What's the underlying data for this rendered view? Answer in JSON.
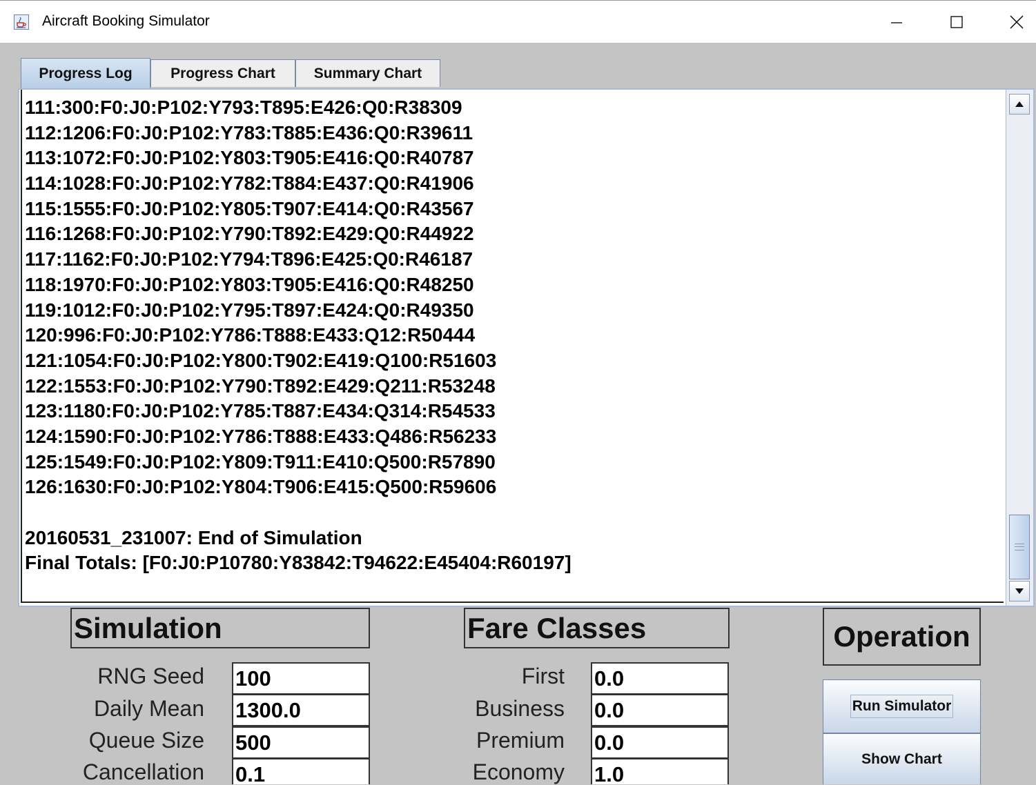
{
  "window": {
    "title": "Aircraft Booking Simulator",
    "icon": "java-cup-icon",
    "controls": [
      "minimize-icon",
      "maximize-icon",
      "close-icon"
    ]
  },
  "tabs": [
    {
      "label": "Progress Log",
      "active": true
    },
    {
      "label": "Progress Chart",
      "active": false
    },
    {
      "label": "Summary Chart",
      "active": false
    }
  ],
  "log": {
    "lines": [
      "111:300:F0:J0:P102:Y793:T895:E426:Q0:R38309",
      "112:1206:F0:J0:P102:Y783:T885:E436:Q0:R39611",
      "113:1072:F0:J0:P102:Y803:T905:E416:Q0:R40787",
      "114:1028:F0:J0:P102:Y782:T884:E437:Q0:R41906",
      "115:1555:F0:J0:P102:Y805:T907:E414:Q0:R43567",
      "116:1268:F0:J0:P102:Y790:T892:E429:Q0:R44922",
      "117:1162:F0:J0:P102:Y794:T896:E425:Q0:R46187",
      "118:1970:F0:J0:P102:Y803:T905:E416:Q0:R48250",
      "119:1012:F0:J0:P102:Y795:T897:E424:Q0:R49350",
      "120:996:F0:J0:P102:Y786:T888:E433:Q12:R50444",
      "121:1054:F0:J0:P102:Y800:T902:E419:Q100:R51603",
      "122:1553:F0:J0:P102:Y790:T892:E429:Q211:R53248",
      "123:1180:F0:J0:P102:Y785:T887:E434:Q314:R54533",
      "124:1590:F0:J0:P102:Y786:T888:E433:Q486:R56233",
      "125:1549:F0:J0:P102:Y809:T911:E410:Q500:R57890",
      "126:1630:F0:J0:P102:Y804:T906:E415:Q500:R59606",
      "",
      "20160531_231007: End of Simulation",
      "Final Totals: [F0:J0:P10780:Y83842:T94622:E45404:R60197]"
    ],
    "scroll_position": 0.87
  },
  "simulation": {
    "heading": "Simulation",
    "fields": [
      {
        "label": "RNG Seed",
        "value": "100"
      },
      {
        "label": "Daily Mean",
        "value": "1300.0"
      },
      {
        "label": "Queue Size",
        "value": "500"
      },
      {
        "label": "Cancellation",
        "value": "0.1"
      }
    ]
  },
  "fare_classes": {
    "heading": "Fare Classes",
    "fields": [
      {
        "label": "First",
        "value": "0.0"
      },
      {
        "label": "Business",
        "value": "0.0"
      },
      {
        "label": "Premium",
        "value": "0.0"
      },
      {
        "label": "Economy",
        "value": "1.0"
      }
    ]
  },
  "operation": {
    "heading": "Operation",
    "run_label": "Run Simulator",
    "chart_label": "Show Chart"
  }
}
